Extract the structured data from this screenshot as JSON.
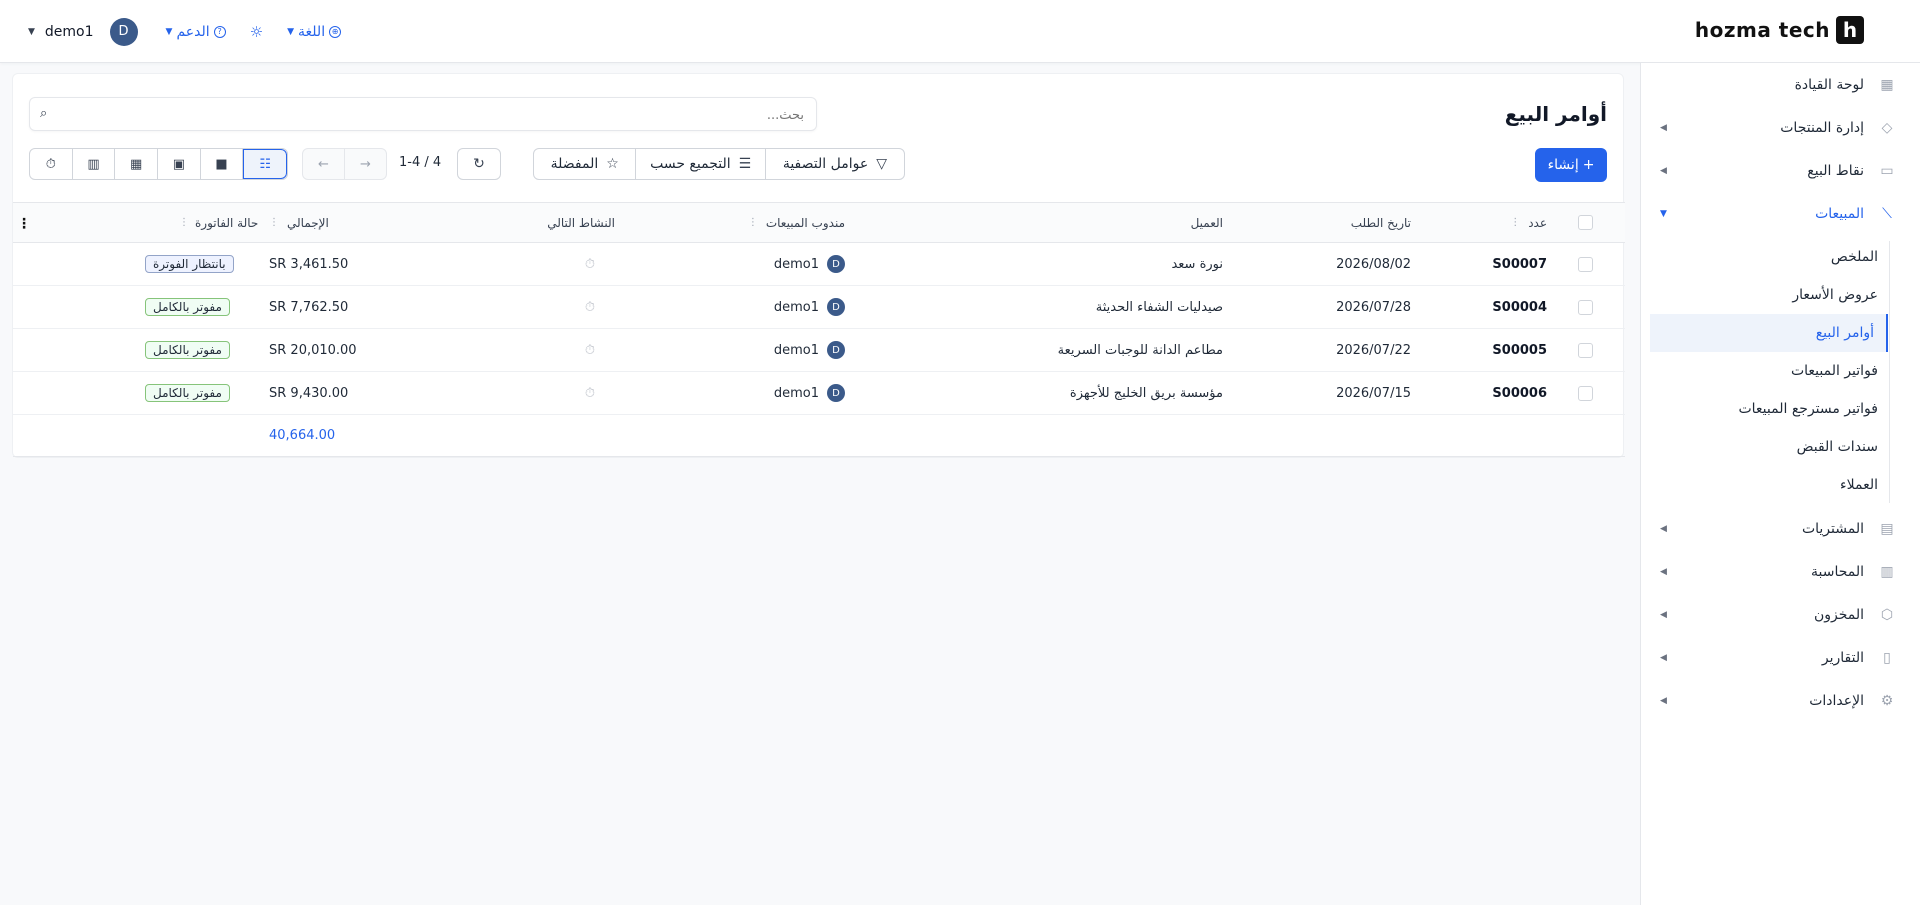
{
  "topbar": {
    "user_name": "demo1",
    "avatar_letter": "D",
    "support_label": "الدعم",
    "language_label": "اللغة",
    "brand_name": "hozma tech",
    "brand_mark": "h"
  },
  "sidebar": {
    "items": [
      {
        "label": "لوحة القيادة",
        "icon": "dashboard-icon"
      },
      {
        "label": "إدارة المنتجات",
        "icon": "tag-icon"
      },
      {
        "label": "نقاط البيع",
        "icon": "store-icon"
      },
      {
        "label": "المبيعات",
        "icon": "chart-icon"
      },
      {
        "label": "المشتريات",
        "icon": "card-icon"
      },
      {
        "label": "المحاسبة",
        "icon": "ledger-icon"
      },
      {
        "label": "المخزون",
        "icon": "box-icon"
      },
      {
        "label": "التقارير",
        "icon": "report-icon"
      },
      {
        "label": "الإعدادات",
        "icon": "gear-icon"
      }
    ],
    "sales_sub": [
      "الملخص",
      "عروض الأسعار",
      "أوامر البيع",
      "فواتير المبيعات",
      "فواتير مسترجع المبيعات",
      "سندات القبض",
      "العملاء"
    ]
  },
  "page": {
    "title": "أوامر البيع",
    "search_placeholder": "بحث...",
    "create_label": "إنشاء",
    "filters_label": "عوامل التصفية",
    "group_by_label": "التجميع حسب",
    "favorites_label": "المفضلة",
    "pager_text": "1-4 / 4"
  },
  "table": {
    "headers": {
      "number": "عدد",
      "order_date": "تاريخ الطلب",
      "customer": "العميل",
      "sales_rep": "مندوب المبيعات",
      "next_activity": "النشاط التالي",
      "total": "الإجمالي",
      "invoice_status": "حالة الفاتورة"
    },
    "rows": [
      {
        "number": "S00007",
        "date": "2026/08/02",
        "customer": "نورة سعد",
        "rep": "demo1",
        "total": "SR 3,461.50",
        "status": "بانتظار الفوترة"
      },
      {
        "number": "S00004",
        "date": "2026/07/28",
        "customer": "صيدليات الشفاء الحديثة",
        "rep": "demo1",
        "total": "SR 7,762.50",
        "status": "مفوتر بالكامل"
      },
      {
        "number": "S00005",
        "date": "2026/07/22",
        "customer": "مطاعم الدانة للوجبات السريعة",
        "rep": "demo1",
        "total": "SR 20,010.00",
        "status": "مفوتر بالكامل"
      },
      {
        "number": "S00006",
        "date": "2026/07/15",
        "customer": "مؤسسة بريق الخليج للأجهزة",
        "rep": "demo1",
        "total": "SR 9,430.00",
        "status": "مفوتر بالكامل"
      }
    ],
    "footer_total": "40,664.00"
  },
  "colors": {
    "accent": "#2563eb",
    "avatar": "#3b5a8a"
  }
}
